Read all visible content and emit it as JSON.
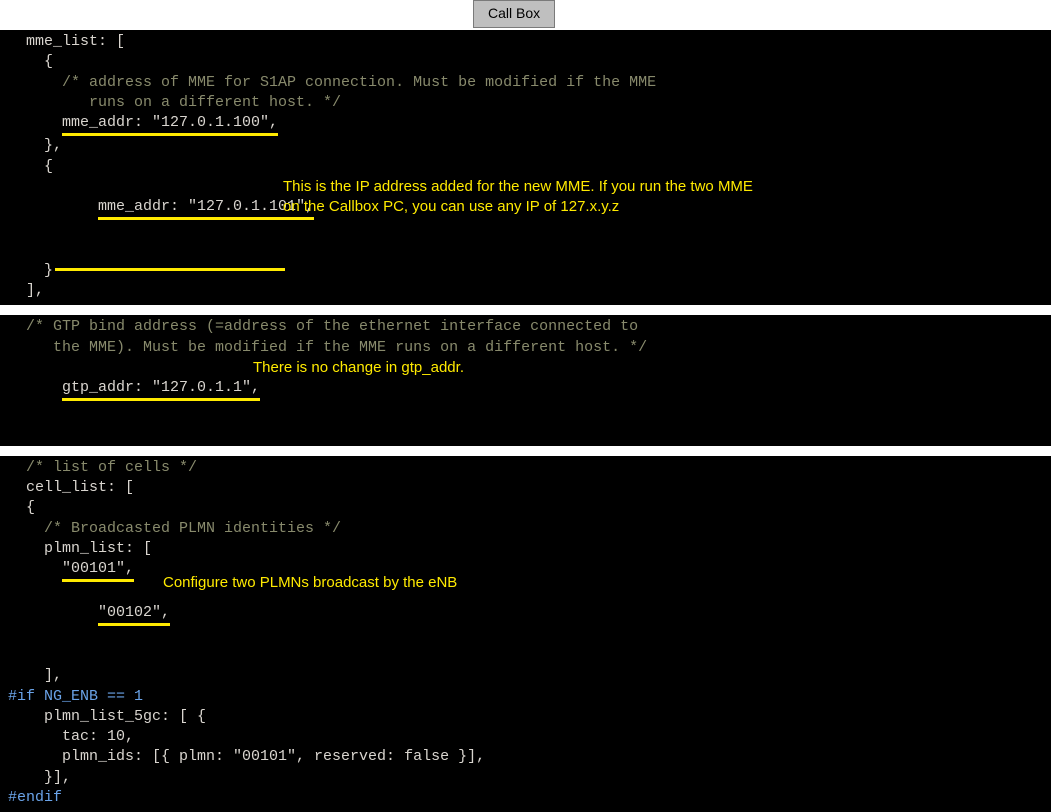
{
  "tab": {
    "label": "Call Box"
  },
  "block1": {
    "l0": "  mme_list: [",
    "l1": "    {",
    "l2_c": "      /* address of MME for S1AP connection. Must be modified if the MME",
    "l3_c": "         runs on a different host. */",
    "l4a": "      ",
    "l4b": "mme_addr: \"127.0.1.100\",",
    "l5": "    },",
    "l6": "    {",
    "l7a": "      ",
    "l7b": "mme_addr: \"127.0.1.101\",",
    "annot1a": "This is the IP address added for the new MME. If you run the two MME",
    "annot1b": "on the Callbox PC, you can use any IP of 127.x.y.z",
    "l8": "    }",
    "l9": "  ],"
  },
  "block2": {
    "l0_c": "  /* GTP bind address (=address of the ethernet interface connected to",
    "l1_c": "     the MME). Must be modified if the MME runs on a different host. */",
    "l2a": "  ",
    "l2b": "gtp_addr: \"127.0.1.1\",",
    "annot2": "There is no change in gtp_addr."
  },
  "block3": {
    "l0_c": "  /* list of cells */",
    "l1": "  cell_list: [",
    "l2": "  {",
    "l3_c": "    /* Broadcasted PLMN identities */",
    "l4": "    plmn_list: [",
    "l5a": "      ",
    "l5b": "\"00101\",",
    "l6a": "      ",
    "l6b": "\"00102\",",
    "annot3": "Configure two PLMNs broadcast by the eNB",
    "l7": "    ],",
    "l8_p": "#if NG_ENB == 1",
    "l9": "    plmn_list_5gc: [ {",
    "l10": "      tac: 10,",
    "l11": "      plmn_ids: [{ plmn: \"00101\", reserved: false }],",
    "l12": "    }],",
    "l13_p": "#endif"
  }
}
